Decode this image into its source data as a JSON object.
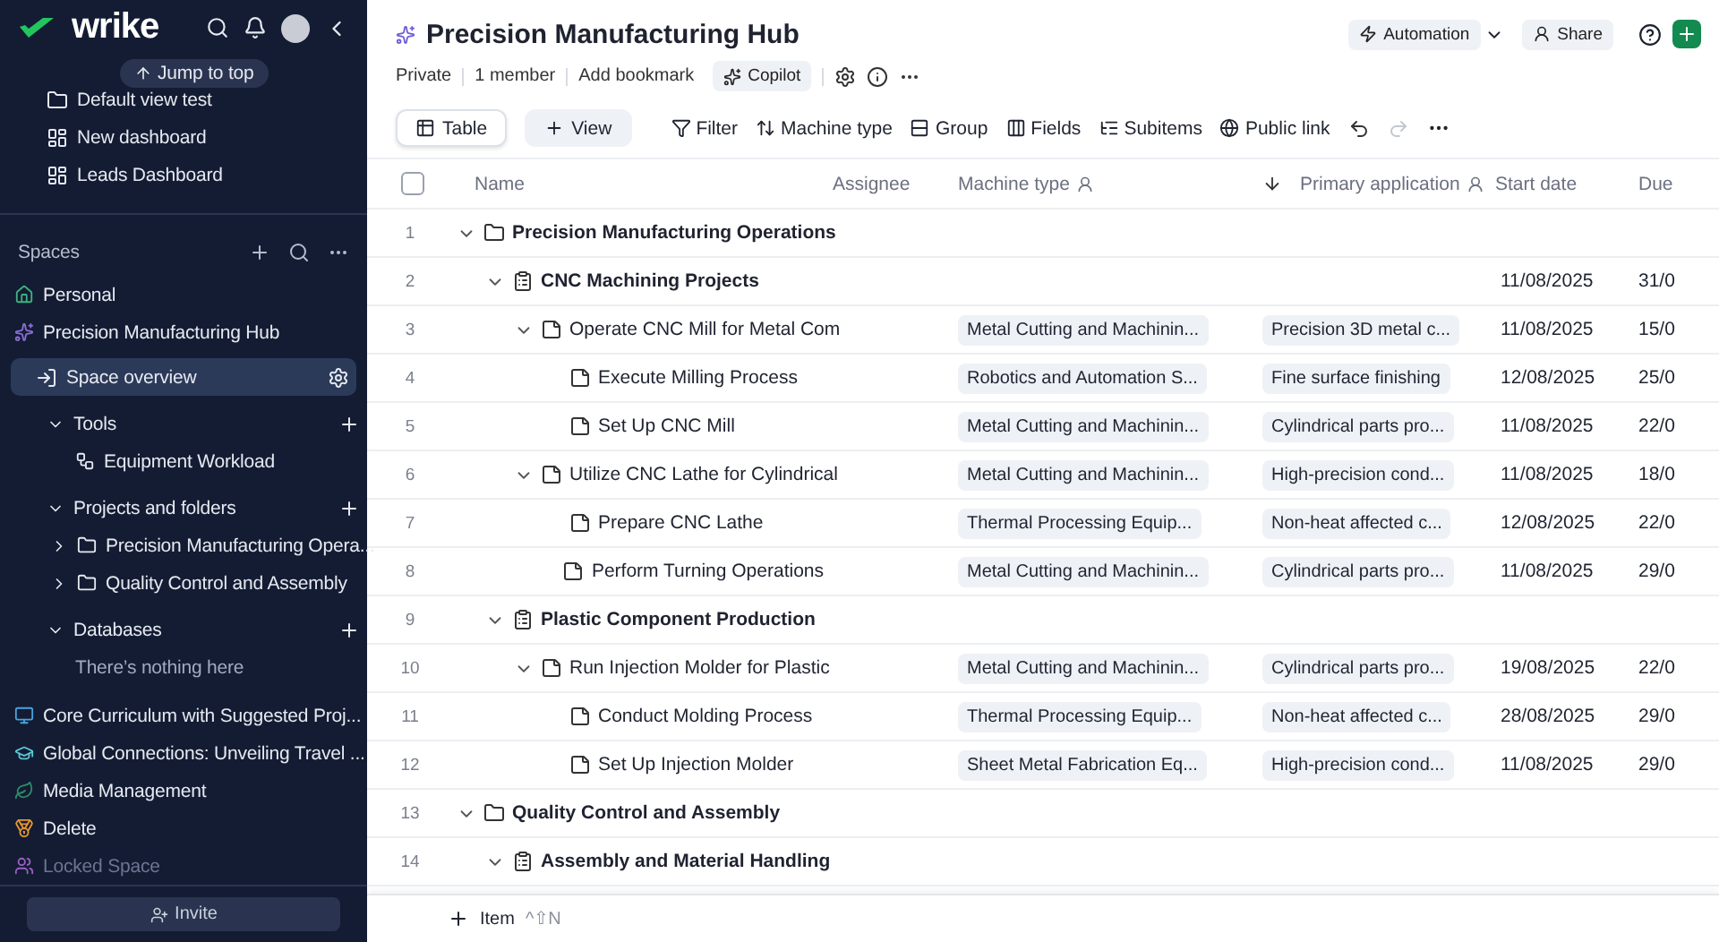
{
  "sidebar": {
    "logo": "wrike",
    "jump_to_top": "Jump to top",
    "top_items": [
      {
        "kind": "folder",
        "label": "Default view test"
      },
      {
        "kind": "dashboard",
        "label": "New dashboard"
      },
      {
        "kind": "dashboard",
        "label": "Leads Dashboard"
      }
    ],
    "spaces_title": "Spaces",
    "spaces": [
      {
        "color": "#3fb27f",
        "label": "Personal",
        "disabled": false
      },
      {
        "color": "#8b6fd6",
        "label": "Precision Manufacturing Hub",
        "disabled": false,
        "children": [
          {
            "kind": "overview",
            "label": "Space overview",
            "selected": true
          },
          {
            "kind": "section",
            "label": "Tools",
            "selected": false,
            "expanded": true,
            "children": [
              {
                "kind": "tool",
                "label": "Equipment Workload"
              }
            ]
          },
          {
            "kind": "section",
            "label": "Projects and folders",
            "selected": false,
            "expanded": true,
            "children": [
              {
                "kind": "folder",
                "label": "Precision Manufacturing Opera...",
                "expanded": false
              },
              {
                "kind": "folder",
                "label": "Quality Control and Assembly",
                "expanded": false
              }
            ]
          },
          {
            "kind": "section",
            "label": "Databases",
            "selected": false,
            "expanded": true,
            "empty_text": "There’s nothing here"
          }
        ]
      },
      {
        "color": "#4aa3df",
        "label": "Core Curriculum with Suggested Proj...",
        "disabled": false
      },
      {
        "color": "#5cc8d6",
        "label": "Global Connections: Unveiling Travel ...",
        "disabled": false
      },
      {
        "color": "#2f8a6a",
        "label": "Media Management",
        "disabled": false
      },
      {
        "color": "#e8972f",
        "label": "Delete",
        "disabled": false
      },
      {
        "color": "#9a5fc4",
        "label": "Locked Space",
        "disabled": true
      }
    ],
    "invite": "Invite"
  },
  "header": {
    "title": "Precision Manufacturing Hub",
    "meta": [
      "Private",
      "1 member",
      "Add bookmark"
    ],
    "copilot": "Copilot",
    "automation": "Automation",
    "share": "Share"
  },
  "toolbar": {
    "views": [
      {
        "label": "Table",
        "selected": true
      }
    ],
    "add_view": "View",
    "actions": [
      "Filter",
      "Machine type",
      "Group",
      "Fields",
      "Subitems",
      "Public link"
    ],
    "undo_disabled": false,
    "redo_disabled": true
  },
  "table": {
    "select_all_checked": false,
    "columns": [
      "Name",
      "Assignee",
      "Machine type",
      "Primary application",
      "Start date",
      "Due"
    ],
    "rows": [
      {
        "num": "1",
        "kind": "folder",
        "name": "Precision Manufacturing Operations",
        "expanded": true,
        "children": [
          {
            "num": "2",
            "kind": "project",
            "name": "CNC Machining Projects",
            "start": "11/08/2025",
            "due": "31/0",
            "expanded": true,
            "children": [
              {
                "num": "3",
                "kind": "task",
                "name": "Operate CNC Mill for Metal Com",
                "machine": "Metal Cutting and Machinin...",
                "application": "Precision 3D metal c...",
                "start": "11/08/2025",
                "due": "15/0",
                "expanded": true,
                "children": [
                  {
                    "num": "4",
                    "kind": "task",
                    "name": "Execute Milling Process",
                    "machine": "Robotics and Automation S...",
                    "application": "Fine surface finishing",
                    "start": "12/08/2025",
                    "due": "25/0"
                  },
                  {
                    "num": "5",
                    "kind": "task",
                    "name": "Set Up CNC Mill",
                    "machine": "Metal Cutting and Machinin...",
                    "application": "Cylindrical parts pro...",
                    "start": "11/08/2025",
                    "due": "22/0"
                  }
                ]
              },
              {
                "num": "6",
                "kind": "task",
                "name": "Utilize CNC Lathe for Cylindrical",
                "machine": "Metal Cutting and Machinin...",
                "application": "High-precision cond...",
                "start": "11/08/2025",
                "due": "18/0",
                "expanded": true,
                "children": [
                  {
                    "num": "7",
                    "kind": "task",
                    "name": "Prepare CNC Lathe",
                    "machine": "Thermal Processing Equip...",
                    "application": "Non-heat affected c...",
                    "start": "12/08/2025",
                    "due": "22/0"
                  },
                  {
                    "num": "8",
                    "kind": "task",
                    "name": "Perform Turning Operations",
                    "machine": "Metal Cutting and Machinin...",
                    "application": "Cylindrical parts pro...",
                    "start": "11/08/2025",
                    "due": "29/0"
                  }
                ]
              }
            ]
          },
          {
            "num": "9",
            "kind": "project",
            "name": "Plastic Component Production",
            "expanded": true,
            "children": [
              {
                "num": "10",
                "kind": "task",
                "name": "Run Injection Molder for Plastic",
                "machine": "Metal Cutting and Machinin...",
                "application": "Cylindrical parts pro...",
                "start": "19/08/2025",
                "due": "22/0",
                "expanded": true,
                "children": [
                  {
                    "num": "11",
                    "kind": "task",
                    "name": "Conduct Molding Process",
                    "machine": "Thermal Processing Equip...",
                    "application": "Non-heat affected c...",
                    "start": "28/08/2025",
                    "due": "29/0"
                  },
                  {
                    "num": "12",
                    "kind": "task",
                    "name": "Set Up Injection Molder",
                    "machine": "Sheet Metal Fabrication Eq...",
                    "application": "High-precision cond...",
                    "start": "11/08/2025",
                    "due": "29/0"
                  }
                ]
              }
            ]
          }
        ]
      },
      {
        "num": "13",
        "kind": "folder",
        "name": "Quality Control and Assembly",
        "expanded": true,
        "children": [
          {
            "num": "14",
            "kind": "project",
            "name": "Assembly and Material Handling",
            "expanded": true
          }
        ]
      }
    ]
  },
  "footer": {
    "add_item": "Item",
    "shortcut": "^⇧N"
  }
}
